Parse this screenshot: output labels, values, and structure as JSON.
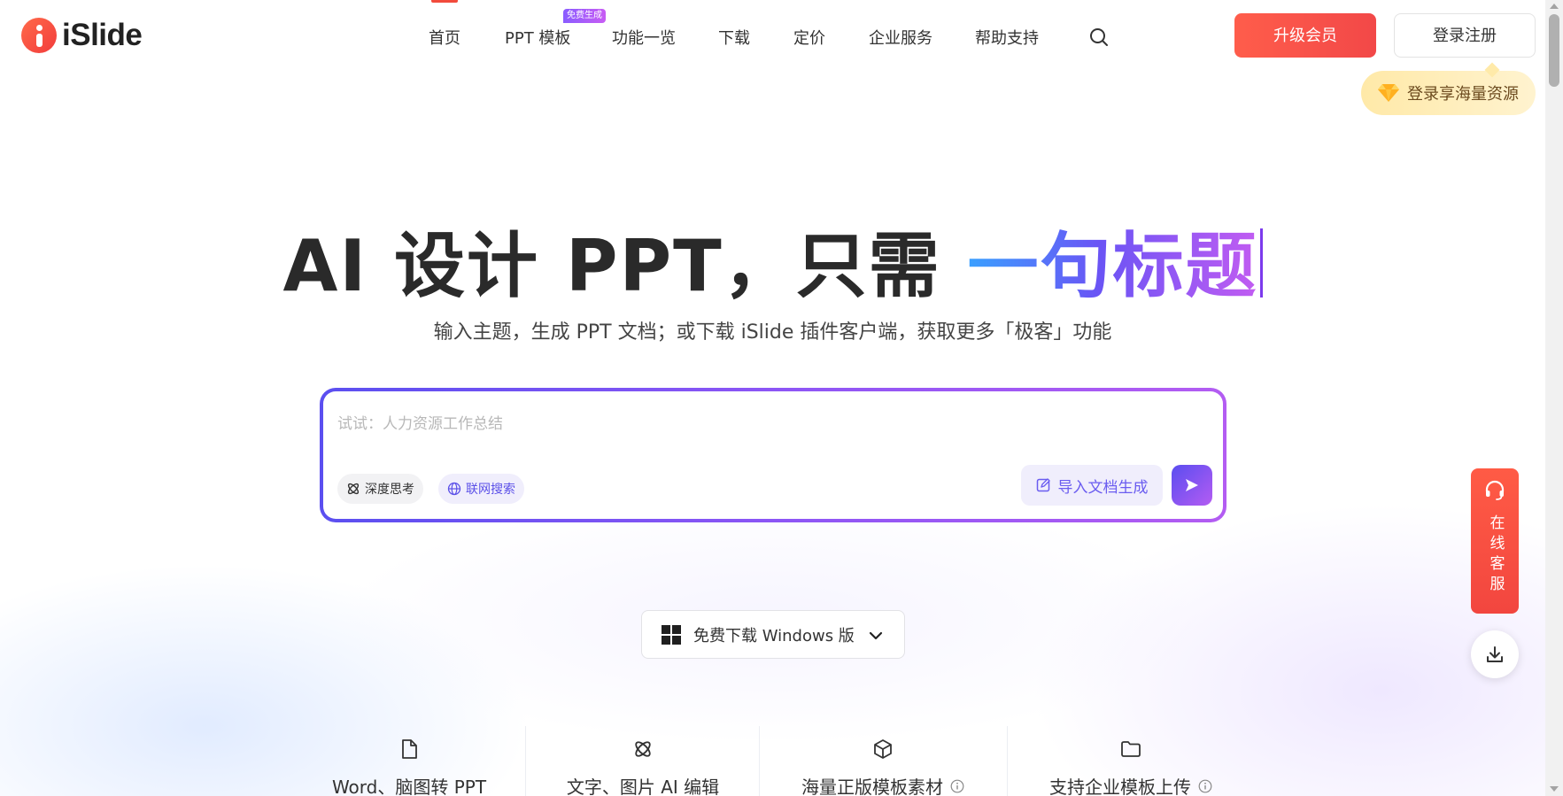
{
  "brand": {
    "logo_text": "iSlide"
  },
  "nav": {
    "items": [
      {
        "label": "首页",
        "active": true
      },
      {
        "label": "PPT 模板",
        "badge": "免费生成"
      },
      {
        "label": "功能一览"
      },
      {
        "label": "下载"
      },
      {
        "label": "定价"
      },
      {
        "label": "企业服务"
      },
      {
        "label": "帮助支持"
      }
    ],
    "search_icon": "search-icon",
    "upgrade_label": "升级会员",
    "login_label": "登录注册",
    "login_tip": "登录享海量资源"
  },
  "hero": {
    "title_plain": "AI 设计 PPT，只需 ",
    "title_highlight": "一句标题",
    "subtitle": "输入主题，生成 PPT 文档；或下载 iSlide 插件客户端，获取更多「极客」功能"
  },
  "prompt": {
    "value": "",
    "placeholder": "试试：人力资源工作总结",
    "chip_deep": "深度思考",
    "chip_web": "联网搜索",
    "import_label": "导入文档生成",
    "send_icon": "send-icon"
  },
  "download": {
    "label": "免费下载 Windows 版"
  },
  "features": [
    {
      "label": "Word、脑图转 PPT",
      "icon": "file-icon",
      "info": false
    },
    {
      "label": "文字、图片 AI 编辑",
      "icon": "atom-icon",
      "info": false
    },
    {
      "label": "海量正版模板素材",
      "icon": "cube-icon",
      "info": true
    },
    {
      "label": "支持企业模板上传",
      "icon": "folder-icon",
      "info": true
    }
  ],
  "float": {
    "service_label": "在线客服"
  },
  "colors": {
    "accent_red": "#f24b3c",
    "accent_purple": "#6a54f5",
    "gradient_blue": "#3aa0ff",
    "gradient_violet": "#c25cf2"
  }
}
